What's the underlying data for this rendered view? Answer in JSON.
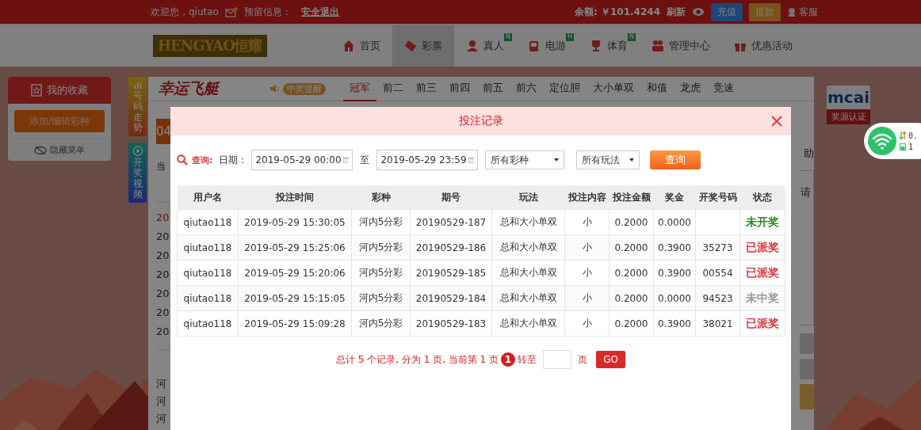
{
  "top_bar": {
    "welcome": "欢迎您，qiutao",
    "message_label": "预留信息：",
    "logout": "安全退出",
    "balance": "余额: ￥101.4244",
    "refresh": "刷新",
    "deposit": "充值",
    "withdraw": "提款",
    "service": "客服"
  },
  "nav": {
    "logo": "HENGYAO恒耀",
    "items": [
      {
        "label": "首页",
        "kind": "home",
        "selected": false
      },
      {
        "label": "彩票",
        "kind": "ticket",
        "selected": true
      },
      {
        "label": "真人",
        "kind": "person",
        "badge": "N",
        "selected": false
      },
      {
        "label": "电游",
        "kind": "game",
        "badge": "H",
        "selected": false
      },
      {
        "label": "体育",
        "kind": "trophy",
        "badge": "N",
        "selected": false
      },
      {
        "label": "管理中心",
        "kind": "people",
        "selected": false
      },
      {
        "label": "优惠活动",
        "kind": "gift",
        "selected": false
      }
    ]
  },
  "sidebar": {
    "title": "我的收藏",
    "add_button": "添加/编辑彩种",
    "hide_menu": "隐藏菜单"
  },
  "side_tabs": [
    {
      "label": "号码走势",
      "kind": "chart"
    },
    {
      "label": "开奖视频",
      "kind": "play"
    }
  ],
  "game": {
    "logo": "幸运飞艇",
    "alert": "中奖提醒",
    "tabs": [
      {
        "label": "冠军",
        "selected": true
      },
      {
        "label": "前二",
        "selected": false
      },
      {
        "label": "前三",
        "selected": false
      },
      {
        "label": "前四",
        "selected": false
      },
      {
        "label": "前五",
        "selected": false
      },
      {
        "label": "前六",
        "selected": false
      },
      {
        "label": "定位胆",
        "selected": false
      },
      {
        "label": "大小单双",
        "selected": false
      },
      {
        "label": "和值",
        "selected": false
      },
      {
        "label": "龙虎",
        "selected": false
      },
      {
        "label": "竞速",
        "selected": false
      }
    ],
    "countdown": "04",
    "current": "当",
    "draw_rows": [
      {
        "text": "20",
        "selected": true
      },
      {
        "text": "20",
        "selected": false
      },
      {
        "text": "20",
        "selected": false
      },
      {
        "text": "20",
        "selected": false
      },
      {
        "text": "20",
        "selected": false
      },
      {
        "text": "20",
        "selected": false
      },
      {
        "text": "20",
        "selected": false
      }
    ],
    "region_rows": [
      "河",
      "河",
      "河"
    ],
    "help": "助",
    "hint": "请"
  },
  "certification": {
    "logo": "mcai",
    "label": "奖源认证"
  },
  "modal": {
    "title": "投注记录",
    "query": {
      "label": "查询:",
      "date_label": "日期：",
      "start": "2019-05-29 00:00",
      "to": "至",
      "end": "2019-05-29 23:59",
      "lottery": "所有彩种",
      "play": "所有玩法",
      "button": "查询"
    },
    "columns": [
      "用户名",
      "投注时间",
      "彩种",
      "期号",
      "玩法",
      "投注内容",
      "投注金额",
      "奖金",
      "开奖号码",
      "状态"
    ],
    "rows": [
      {
        "user": "qiutao118",
        "time": "2019-05-29 15:30:05",
        "lottery": "河内5分彩",
        "issue": "20190529-187",
        "play": "总和大小单双",
        "content": "小",
        "amount": "0.2000",
        "prize": "0.0000",
        "status": "未开奖",
        "color": "#2a8a2a"
      },
      {
        "user": "qiutao118",
        "time": "2019-05-29 15:25:06",
        "lottery": "河内5分彩",
        "issue": "20190529-186",
        "play": "总和大小单双",
        "content": "小",
        "amount": "0.2000",
        "prize": "0.3900",
        "draw": "35273",
        "status": "已派奖",
        "color": "#d9343a"
      },
      {
        "user": "qiutao118",
        "time": "2019-05-29 15:20:06",
        "lottery": "河内5分彩",
        "issue": "20190529-185",
        "play": "总和大小单双",
        "content": "小",
        "amount": "0.2000",
        "prize": "0.3900",
        "draw": "00554",
        "status": "已派奖",
        "color": "#d9343a"
      },
      {
        "user": "qiutao118",
        "time": "2019-05-29 15:15:05",
        "lottery": "河内5分彩",
        "issue": "20190529-184",
        "play": "总和大小单双",
        "content": "小",
        "amount": "0.2000",
        "prize": "0.0000",
        "draw": "94523",
        "status": "未中奖",
        "color": "#999999"
      },
      {
        "user": "qiutao118",
        "time": "2019-05-29 15:09:28",
        "lottery": "河内5分彩",
        "issue": "20190529-183",
        "play": "总和大小单双",
        "content": "小",
        "amount": "0.2000",
        "prize": "0.3900",
        "draw": "38021",
        "status": "已派奖",
        "color": "#d9343a"
      }
    ],
    "pager": {
      "summary": "总计 5 个记录, 分为 1 页, 当前第 1 页",
      "page": "1",
      "goto": "转至",
      "unit": "页",
      "button": "GO"
    }
  },
  "network_widget": {
    "speed": "0.",
    "battery": "1"
  }
}
